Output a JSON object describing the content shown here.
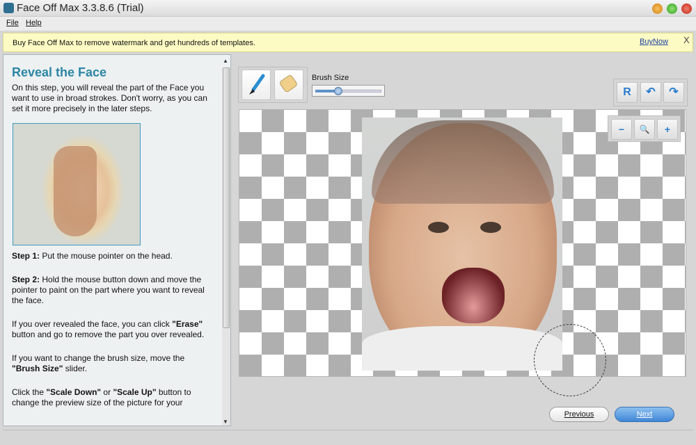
{
  "window": {
    "title": "Face Off Max  3.3.8.6  (Trial)"
  },
  "menu": [
    "File",
    "Help"
  ],
  "banner": {
    "message": "Buy Face Off Max to remove watermark and get hundreds of templates.",
    "link": "BuyNow",
    "close": "X"
  },
  "left_panel": {
    "title": "Reveal the Face",
    "intro": "On this step, you will reveal the part of the Face you want to use in broad strokes. Don't worry, as you can set it more precisely in the later steps.",
    "step1_label": "Step 1:",
    "step1_text": " Put the mouse pointer on the head.",
    "step2_label": "Step 2:",
    "step2_text": " Hold the mouse button down and move the pointer to paint on the part where you want to reveal the face.",
    "p3_a": "If you over revealed the face, you can click ",
    "p3_b": "\"Erase\"",
    "p3_c": " button and go to remove the part you over revealed.",
    "p4_a": "If you want to change the brush size, move the ",
    "p4_b": "\"Brush Size\"",
    "p4_c": " slider.",
    "p5_a": "Click the ",
    "p5_b": "\"Scale Down\"",
    "p5_c": " or ",
    "p5_d": "\"Scale Up\"",
    "p5_e": " button to change the preview size of the picture for your"
  },
  "toolbar": {
    "brush_size_label": "Brush Size",
    "brush_size_percent": 35,
    "reset": "R",
    "undo": "↶",
    "redo": "↷"
  },
  "zoom": {
    "out": "−",
    "fit": "🔍",
    "in": "+"
  },
  "nav": {
    "previous": "Previous",
    "next": "Next"
  },
  "colors": {
    "accent": "#2b86a5",
    "next_button": "#4a8fd8",
    "banner": "#fdfbc4"
  }
}
